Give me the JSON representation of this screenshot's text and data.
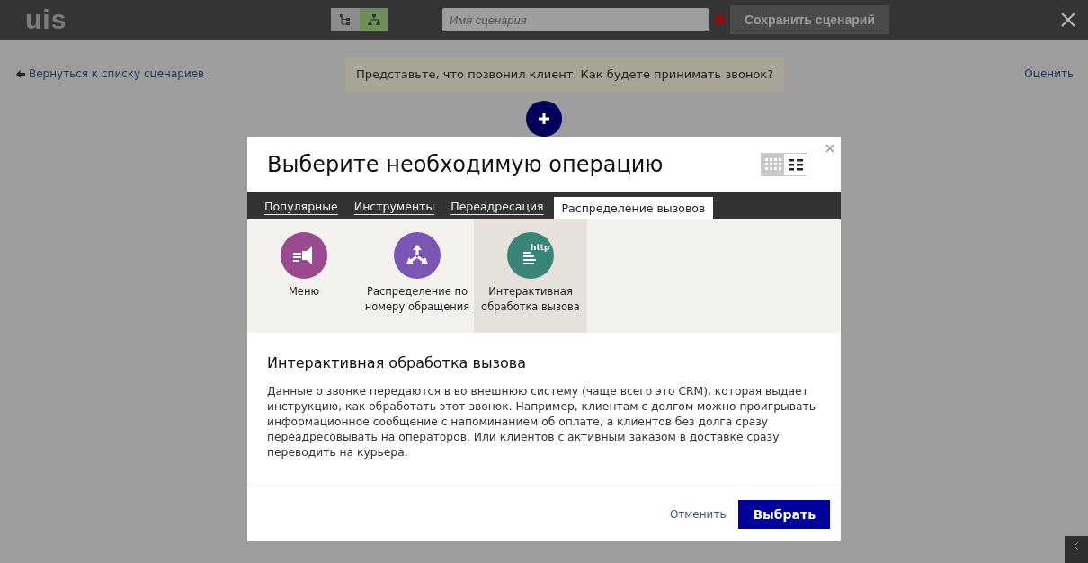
{
  "header": {
    "logo": "uis",
    "view_toggle": [
      {
        "selected": false
      },
      {
        "selected": true
      }
    ],
    "name_field": {
      "placeholder": "Имя сценария",
      "error": true
    },
    "save_button": {
      "label": "Сохранить сценарий",
      "disabled": true
    }
  },
  "back_link": "Вернуться к списку сценариев",
  "question": "Представьте, что позвонил клиент. Как будете принимать звонок?",
  "rate_link": "Оценить",
  "dialog": {
    "title": "Выберите необходимую операцию",
    "layout_toggle": [
      {
        "selected": true
      },
      {
        "selected": false
      }
    ],
    "tabs": [
      {
        "label": "Популярные",
        "selected": false
      },
      {
        "label": "Инструменты",
        "selected": false
      },
      {
        "label": "Переадресация",
        "selected": false
      },
      {
        "label": "Распределение вызовов",
        "selected": true
      }
    ],
    "items": [
      {
        "kind": "menu",
        "label": "Меню",
        "color": "#9b4a8f",
        "selected": false
      },
      {
        "kind": "distribution",
        "label": "Распределение по номеру обращения",
        "color": "#7b57b3",
        "selected": false
      },
      {
        "kind": "http",
        "label": "Интерактивная обработка вызова",
        "icon_text": "http",
        "color": "#3b8478",
        "selected": true
      }
    ],
    "description_title": "Интерактивная обработка вызова",
    "description": "Данные о звонке передаются в во внешнюю систему (чаще всего это CRM), которая выдает инструкцию, как обработать этот звонок. Например, клиентам с долгом можно проигрывать информационное сообщение с напоминанием об оплате, а клиентов без долга сразу переадресовывать на операторов. Или клиентов с активным заказом в доставке сразу переводить на курьера.",
    "cancel": "Отменить",
    "confirm": "Выбрать"
  }
}
